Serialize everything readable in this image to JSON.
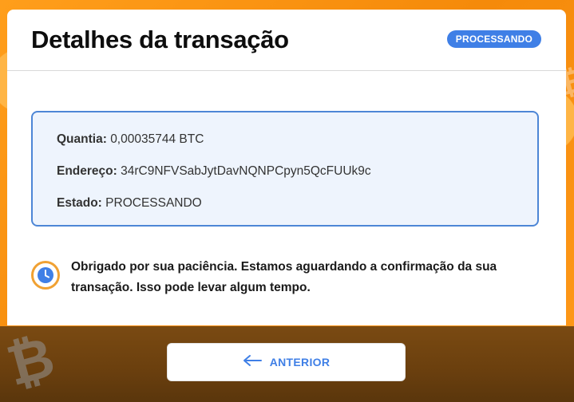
{
  "header": {
    "title": "Detalhes da transação",
    "status_badge": "PROCESSANDO"
  },
  "details": {
    "amount_label": "Quantia:",
    "amount_value": "0,00035744 BTC",
    "address_label": "Endereço:",
    "address_value": "34rC9NFVSabJytDavNQNPCpyn5QcFUUk9c",
    "status_label": "Estado:",
    "status_value": "PROCESSANDO"
  },
  "notice": {
    "icon": "clock-icon",
    "text": "Obrigado por sua paciência. Estamos aguardando a confirmação da sua transação. Isso pode levar algum tempo."
  },
  "footer": {
    "back_icon": "arrow-left-icon",
    "back_label": "ANTERIOR"
  },
  "colors": {
    "accent": "#3f7fe6",
    "background": "#f7931a",
    "clock_ring": "#f0a133"
  }
}
